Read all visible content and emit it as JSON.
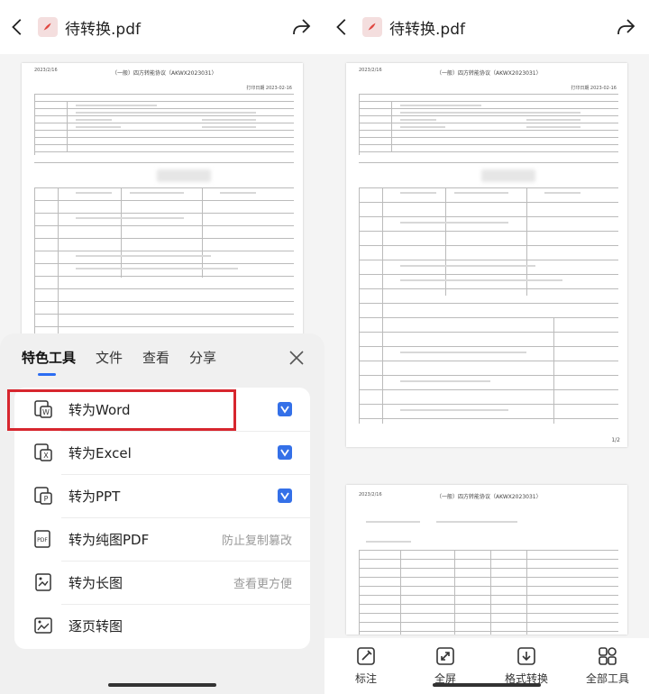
{
  "header": {
    "title": "待转换.pdf"
  },
  "document": {
    "doc_title": "（一般）四方转能协议（AKWX2023031）",
    "date_label": "2023/2/16",
    "print_label": "打印日期 2023-02-16",
    "page_indicator": "1/2"
  },
  "sheet": {
    "tabs": [
      "特色工具",
      "文件",
      "查看",
      "分享"
    ],
    "active_tab": "特色工具",
    "items": [
      {
        "label": "转为Word",
        "icon": "word-convert-icon",
        "hint": ""
      },
      {
        "label": "转为Excel",
        "icon": "excel-convert-icon",
        "hint": ""
      },
      {
        "label": "转为PPT",
        "icon": "ppt-convert-icon",
        "hint": ""
      },
      {
        "label": "转为纯图PDF",
        "icon": "image-pdf-icon",
        "hint": "防止复制篡改"
      },
      {
        "label": "转为长图",
        "icon": "long-image-icon",
        "hint": "查看更方便"
      },
      {
        "label": "逐页转图",
        "icon": "page-image-icon",
        "hint": ""
      }
    ]
  },
  "toolbar": {
    "items": [
      {
        "label": "标注",
        "icon": "annotate-icon"
      },
      {
        "label": "全屏",
        "icon": "fullscreen-icon"
      },
      {
        "label": "格式转换",
        "icon": "format-convert-icon"
      },
      {
        "label": "全部工具",
        "icon": "all-tools-icon"
      }
    ]
  },
  "colors": {
    "accent": "#2c6df2",
    "highlight_border": "#d7262e",
    "pdf_red": "#e0463f"
  }
}
